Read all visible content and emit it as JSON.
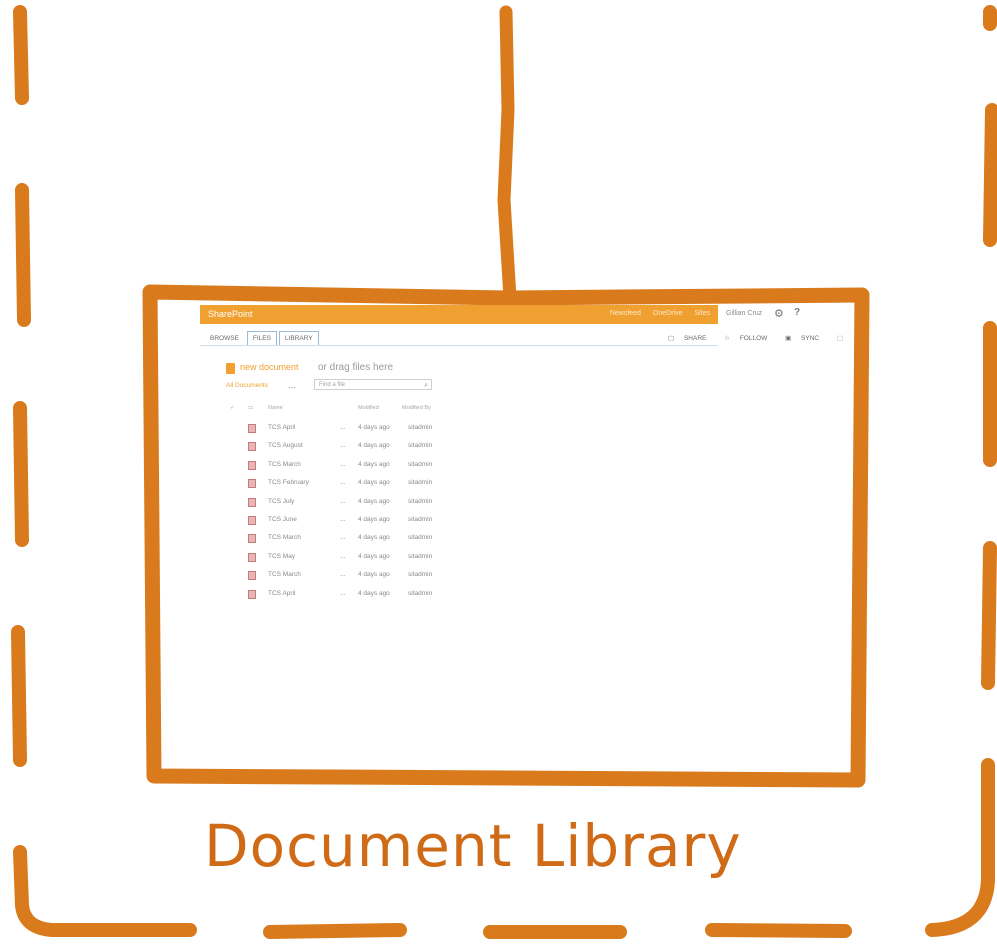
{
  "caption": "Document Library",
  "colors": {
    "stroke": "#d97a1c",
    "sp_orange": "#f0a030",
    "caption": "#cf6b17"
  },
  "screenshot": {
    "suite_bar": {
      "brand": "SharePoint",
      "links": [
        "Newsfeed",
        "OneDrive",
        "Sites"
      ],
      "user": "Gillian Cruz"
    },
    "gear_icon": "gear-icon",
    "help_icon": "help-icon",
    "ribbon_tabs": [
      "BROWSE",
      "FILES",
      "LIBRARY"
    ],
    "ribbon_actions": [
      "SHARE",
      "FOLLOW",
      "SYNC"
    ],
    "library_title": "new document",
    "library_title_rest": "or drag files here",
    "view": "All Documents",
    "view_more": "...",
    "search_placeholder": "Find a file",
    "columns": [
      "Name",
      "Modified",
      "Modified By"
    ],
    "files": [
      {
        "name": "TCS April",
        "ellipsis": "...",
        "modified": "4 days ago",
        "by": "sitadmin"
      },
      {
        "name": "TCS August",
        "ellipsis": "...",
        "modified": "4 days ago",
        "by": "sitadmin"
      },
      {
        "name": "TCS March",
        "ellipsis": "...",
        "modified": "4 days ago",
        "by": "sitadmin"
      },
      {
        "name": "TCS February",
        "ellipsis": "...",
        "modified": "4 days ago",
        "by": "sitadmin"
      },
      {
        "name": "TCS July",
        "ellipsis": "...",
        "modified": "4 days ago",
        "by": "sitadmin"
      },
      {
        "name": "TCS June",
        "ellipsis": "...",
        "modified": "4 days ago",
        "by": "sitadmin"
      },
      {
        "name": "TCS March",
        "ellipsis": "...",
        "modified": "4 days ago",
        "by": "sitadmin"
      },
      {
        "name": "TCS May",
        "ellipsis": "...",
        "modified": "4 days ago",
        "by": "sitadmin"
      },
      {
        "name": "TCS March",
        "ellipsis": "...",
        "modified": "4 days ago",
        "by": "sitadmin"
      },
      {
        "name": "TCS April",
        "ellipsis": "...",
        "modified": "4 days ago",
        "by": "sitadmin"
      }
    ]
  }
}
